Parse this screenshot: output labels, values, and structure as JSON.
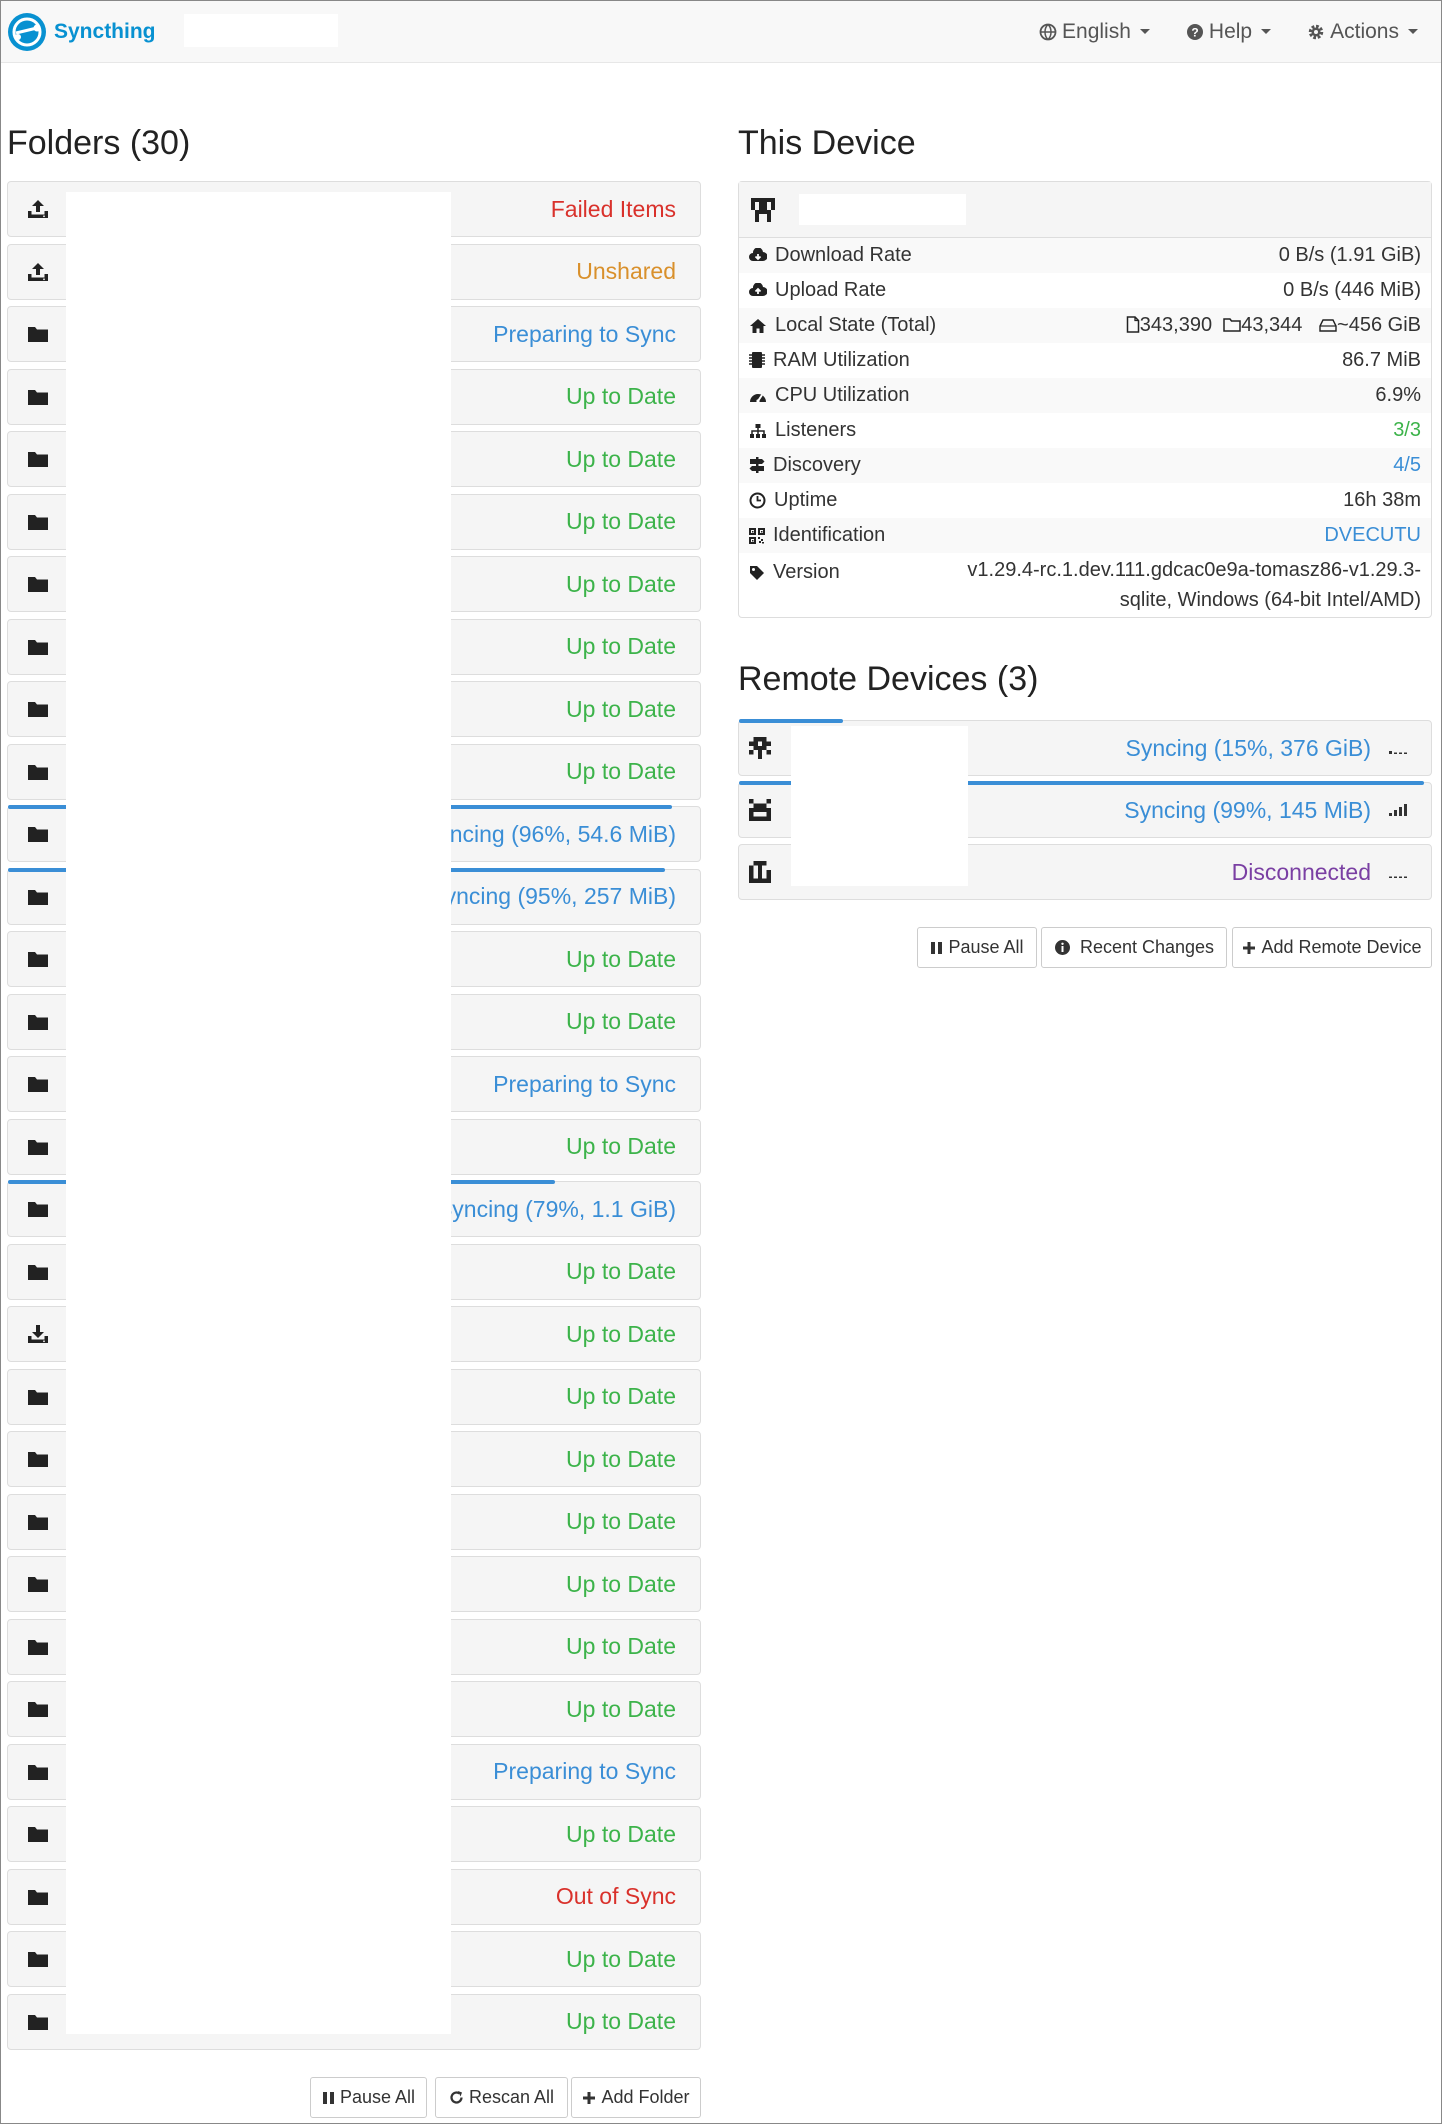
{
  "app": {
    "brand": "Syncthing",
    "brand_color": "#0891d1",
    "nav": {
      "language": "English",
      "help": "Help",
      "actions": "Actions"
    }
  },
  "folders": {
    "title": "Folders (30)",
    "items": [
      {
        "icon": "upload-icon",
        "status": "Failed Items",
        "color": "red"
      },
      {
        "icon": "upload-icon",
        "status": "Unshared",
        "color": "orange"
      },
      {
        "icon": "folder-icon",
        "status": "Preparing to Sync",
        "color": "blue"
      },
      {
        "icon": "folder-icon",
        "status": "Up to Date",
        "color": "green"
      },
      {
        "icon": "folder-icon",
        "status": "Up to Date",
        "color": "green"
      },
      {
        "icon": "folder-icon",
        "status": "Up to Date",
        "color": "green"
      },
      {
        "icon": "folder-icon",
        "status": "Up to Date",
        "color": "green"
      },
      {
        "icon": "folder-icon",
        "status": "Up to Date",
        "color": "green"
      },
      {
        "icon": "folder-icon",
        "status": "Up to Date",
        "color": "green"
      },
      {
        "icon": "folder-icon",
        "status": "Up to Date",
        "color": "green"
      },
      {
        "icon": "folder-icon",
        "status": "Syncing (96%, 54.6 MiB)",
        "color": "blue",
        "progress": 0.96
      },
      {
        "icon": "folder-icon",
        "status": "Syncing (95%, 257 MiB)",
        "color": "blue",
        "progress": 0.95
      },
      {
        "icon": "folder-icon",
        "status": "Up to Date",
        "color": "green"
      },
      {
        "icon": "folder-icon",
        "status": "Up to Date",
        "color": "green"
      },
      {
        "icon": "folder-icon",
        "status": "Preparing to Sync",
        "color": "blue"
      },
      {
        "icon": "folder-icon",
        "status": "Up to Date",
        "color": "green"
      },
      {
        "icon": "folder-icon",
        "status": "Syncing (79%, 1.1 GiB)",
        "color": "blue",
        "progress": 0.79
      },
      {
        "icon": "folder-icon",
        "status": "Up to Date",
        "color": "green"
      },
      {
        "icon": "download-icon",
        "status": "Up to Date",
        "color": "green"
      },
      {
        "icon": "folder-icon",
        "status": "Up to Date",
        "color": "green"
      },
      {
        "icon": "folder-icon",
        "status": "Up to Date",
        "color": "green"
      },
      {
        "icon": "folder-icon",
        "status": "Up to Date",
        "color": "green"
      },
      {
        "icon": "folder-icon",
        "status": "Up to Date",
        "color": "green"
      },
      {
        "icon": "folder-icon",
        "status": "Up to Date",
        "color": "green"
      },
      {
        "icon": "folder-icon",
        "status": "Up to Date",
        "color": "green"
      },
      {
        "icon": "folder-icon",
        "status": "Preparing to Sync",
        "color": "blue"
      },
      {
        "icon": "folder-icon",
        "status": "Up to Date",
        "color": "green"
      },
      {
        "icon": "folder-icon",
        "status": "Out of Sync",
        "color": "red"
      },
      {
        "icon": "folder-icon",
        "status": "Up to Date",
        "color": "green"
      },
      {
        "icon": "folder-icon",
        "status": "Up to Date",
        "color": "green"
      }
    ],
    "buttons": {
      "pause_all": "Pause All",
      "rescan_all": "Rescan All",
      "add_folder": "Add Folder"
    }
  },
  "this_device": {
    "title": "This Device",
    "rows": {
      "download_rate": {
        "label": "Download Rate",
        "value": "0 B/s (1.91 GiB)"
      },
      "upload_rate": {
        "label": "Upload Rate",
        "value": "0 B/s (446 MiB)"
      },
      "local_state": {
        "label": "Local State (Total)",
        "files": "343,390",
        "dirs": "43,344",
        "size": "~456 GiB"
      },
      "ram": {
        "label": "RAM Utilization",
        "value": "86.7 MiB"
      },
      "cpu": {
        "label": "CPU Utilization",
        "value": "6.9%"
      },
      "listeners": {
        "label": "Listeners",
        "value": "3/3"
      },
      "discovery": {
        "label": "Discovery",
        "value": "4/5"
      },
      "uptime": {
        "label": "Uptime",
        "value": "16h 38m"
      },
      "identification": {
        "label": "Identification",
        "value": "DVECUTU"
      },
      "version": {
        "label": "Version",
        "value_line1": "v1.29.4-rc.1.dev.111.gdcac0e9a-tomasz86-v1.29.3-",
        "value_line2": "sqlite, Windows (64-bit Intel/AMD)"
      }
    }
  },
  "remote_devices": {
    "title": "Remote Devices (3)",
    "items": [
      {
        "status": "Syncing (15%, 376 GiB)",
        "color": "blue",
        "progress": 0.15,
        "signal": "weak"
      },
      {
        "status": "Syncing (99%, 145 MiB)",
        "color": "blue",
        "progress": 0.99,
        "signal": "strong"
      },
      {
        "status": "Disconnected",
        "color": "purple",
        "signal": "none"
      }
    ],
    "buttons": {
      "pause_all": "Pause All",
      "recent_changes": "Recent Changes",
      "add_remote_device": "Add Remote Device"
    }
  },
  "colors": {
    "green": "#3cb34a",
    "blue": "#3a8ed6",
    "red": "#d9312b",
    "orange": "#d9902b",
    "purple": "#7a3fa3"
  }
}
